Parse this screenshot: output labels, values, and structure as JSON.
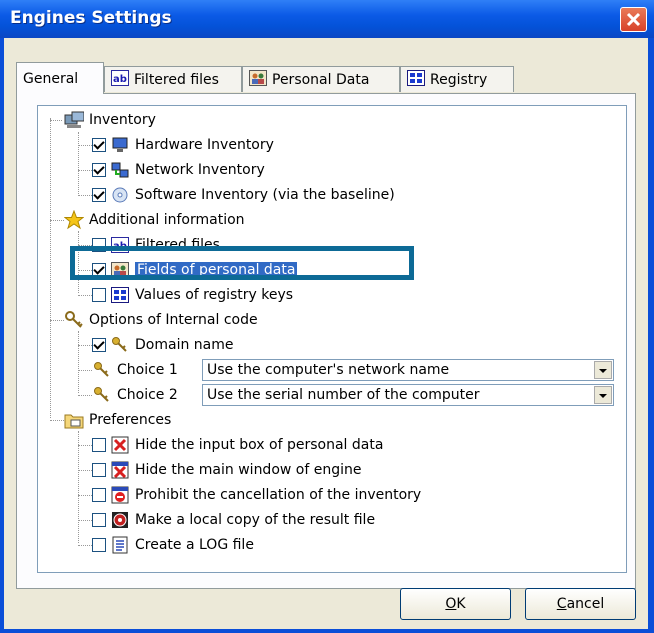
{
  "window": {
    "title": "Engines Settings"
  },
  "tabs": [
    {
      "label": "General",
      "icon": "none"
    },
    {
      "label": "Filtered files",
      "icon": "ab-text-icon"
    },
    {
      "label": "Personal Data",
      "icon": "people-icon"
    },
    {
      "label": "Registry",
      "icon": "registry-icon"
    }
  ],
  "tree": {
    "inventory": {
      "label": "Inventory",
      "items": [
        {
          "label": "Hardware Inventory",
          "checked": true
        },
        {
          "label": "Network Inventory",
          "checked": true
        },
        {
          "label": "Software Inventory (via the baseline)",
          "checked": true
        }
      ]
    },
    "additional": {
      "label": "Additional information",
      "items": [
        {
          "label": "Filtered files",
          "checked": false
        },
        {
          "label": "Fields of personal data",
          "checked": true
        },
        {
          "label": "Values of registry keys",
          "checked": false
        }
      ]
    },
    "internal_code": {
      "label": "Options of Internal code",
      "domain": {
        "label": "Domain name",
        "checked": true
      },
      "choice1": {
        "label": "Choice 1",
        "value": "Use the computer's network name"
      },
      "choice2": {
        "label": "Choice 2",
        "value": "Use the serial number of the computer"
      }
    },
    "preferences": {
      "label": "Preferences",
      "items": [
        {
          "label": "Hide the input box of personal data",
          "checked": false
        },
        {
          "label": "Hide the main window of engine",
          "checked": false
        },
        {
          "label": "Prohibit the cancellation of the inventory",
          "checked": false
        },
        {
          "label": "Make a local copy of the result file",
          "checked": false
        },
        {
          "label": "Create a LOG file",
          "checked": false
        }
      ]
    }
  },
  "buttons": {
    "ok": {
      "mnemonic": "O",
      "rest": "K"
    },
    "cancel": {
      "mnemonic": "C",
      "rest": "ancel"
    }
  },
  "colors": {
    "titlebar": "#0a4ed8",
    "highlight": "#0d6a96",
    "face": "#ece9d8"
  }
}
